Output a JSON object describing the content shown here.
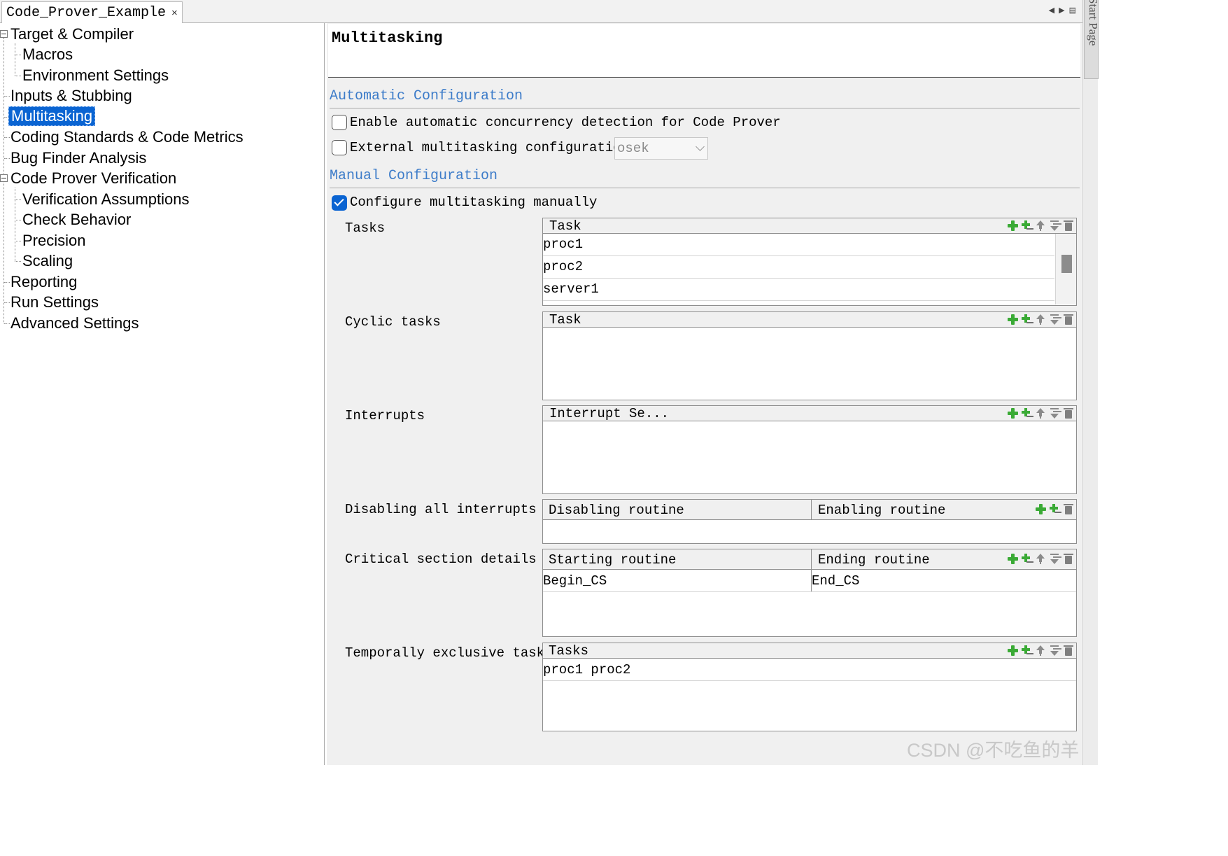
{
  "document_tab": {
    "label": "Code_Prover_Example",
    "close": "×"
  },
  "tab_controls": {
    "prev": "◀",
    "next": "▶",
    "menu": "▤"
  },
  "side_tab": {
    "label": "Start Page"
  },
  "tree": [
    {
      "label": "Target & Compiler"
    },
    {
      "label": "Macros"
    },
    {
      "label": "Environment Settings"
    },
    {
      "label": "Inputs & Stubbing"
    },
    {
      "label": "Multitasking",
      "selected": true
    },
    {
      "label": "Coding Standards & Code Metrics"
    },
    {
      "label": "Bug Finder Analysis"
    },
    {
      "label": "Code Prover Verification"
    },
    {
      "label": "Verification Assumptions"
    },
    {
      "label": "Check Behavior"
    },
    {
      "label": "Precision"
    },
    {
      "label": "Scaling"
    },
    {
      "label": "Reporting"
    },
    {
      "label": "Run Settings"
    },
    {
      "label": "Advanced Settings"
    }
  ],
  "page": {
    "title": "Multitasking"
  },
  "auto_config": {
    "heading": "Automatic Configuration",
    "enable_label": "Enable automatic concurrency detection for Code Prover",
    "enable_checked": false,
    "external_label": "External multitasking configuration",
    "external_checked": false,
    "external_value": "osek"
  },
  "manual_config": {
    "heading": "Manual Configuration",
    "configure_label": "Configure multitasking manually",
    "configure_checked": true
  },
  "tasks": {
    "label": "Tasks",
    "header": "Task",
    "rows": [
      "proc1",
      "proc2",
      "server1"
    ]
  },
  "cyclic": {
    "label": "Cyclic tasks",
    "header": "Task"
  },
  "interrupts": {
    "label": "Interrupts",
    "header": "Interrupt Se..."
  },
  "disabling": {
    "label": "Disabling all interrupts",
    "col1": "Disabling routine",
    "col2": "Enabling routine"
  },
  "critical": {
    "label": "Critical section details",
    "col1": "Starting routine",
    "col2": "Ending routine",
    "rows": [
      {
        "start": "Begin_CS",
        "end": "End_CS"
      }
    ]
  },
  "temporal": {
    "label": "Temporally exclusive tasks",
    "header": "Tasks",
    "rows": [
      "proc1 proc2"
    ]
  },
  "watermark": "CSDN @不吃鱼的羊",
  "colors": {
    "accent": "#0a64d2",
    "section_heading": "#3d7cc9",
    "add_icon": "#3aaa35"
  }
}
